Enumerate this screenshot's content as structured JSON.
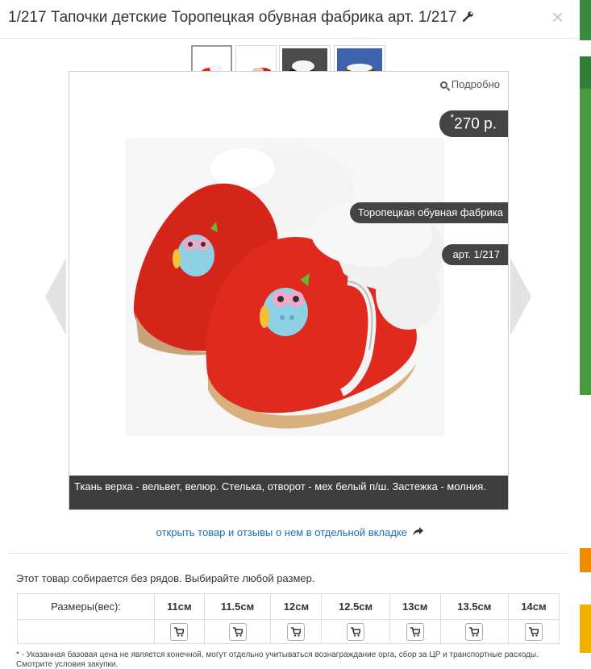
{
  "modal": {
    "title": "1/217 Тапочки детские Торопецкая обувная фабрика арт. 1/217",
    "close_glyph": "×"
  },
  "gallery": {
    "details_label": "Подробно",
    "price_mark": "*",
    "price": "270 р.",
    "brand": "Торопецкая обувная фабрика",
    "article": "арт. 1/217",
    "description": "Ткань верха - вельвет, велюр. Стелька, отворот - мех белый п/ш. Застежка - молния.",
    "thumbnail_count": 4,
    "active_thumbnail": 1
  },
  "open_link": "открыть товар и отзывы о нем в отдельной вкладке",
  "notice": "Этот товар собирается без рядов. Выбирайте любой размер.",
  "sizes": {
    "header_label": "Размеры(вес):",
    "values": [
      "11см",
      "11.5см",
      "12см",
      "12.5см",
      "13см",
      "13.5см",
      "14см"
    ]
  },
  "footnote": "* - Указанная базовая цена не является конечной, могут отдельно учитываться вознаграждание орга, сбор за ЦР и транспортные расходы. Смотрите условия закупки.",
  "icons": {
    "wrench": "wrench-icon",
    "close": "close-icon",
    "search": "search-icon",
    "share": "share-icon",
    "cart": "cart-icon"
  },
  "colors": {
    "tag_bg": "#444444",
    "link": "#1a6fb0",
    "shoe_red": "#d42a1e"
  }
}
